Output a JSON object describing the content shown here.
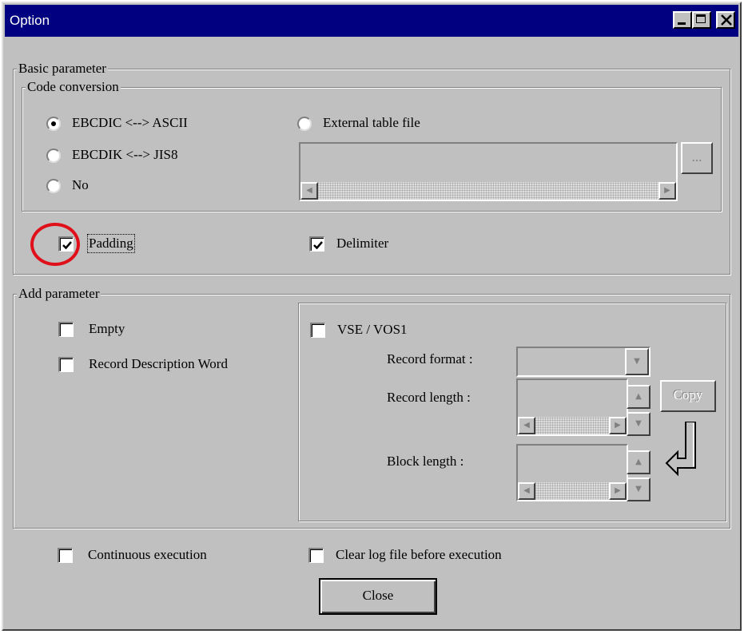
{
  "window": {
    "title": "Option"
  },
  "basic": {
    "label": "Basic parameter",
    "code_conversion": {
      "label": "Code conversion",
      "options": [
        "EBCDIC <--> ASCII",
        "EBCDIK <--> JIS8",
        "No"
      ],
      "selected": "EBCDIC <--> ASCII",
      "external_label": "External table file",
      "browse_label": "..."
    },
    "padding_label": "Padding",
    "padding_checked": true,
    "delimiter_label": "Delimiter",
    "delimiter_checked": true
  },
  "add": {
    "label": "Add parameter",
    "empty_label": "Empty",
    "rdw_label": "Record Description Word",
    "vse_label": "VSE / VOS1",
    "record_format_label": "Record format :",
    "record_length_label": "Record length :",
    "block_length_label": "Block length :",
    "copy_label": "Copy"
  },
  "footer": {
    "continuous_label": "Continuous execution",
    "clear_log_label": "Clear log file before execution",
    "close_label": "Close"
  },
  "colors": {
    "titlebar": "#000080",
    "face": "#c0c0c0",
    "highlight_annotation": "#e0101a"
  }
}
